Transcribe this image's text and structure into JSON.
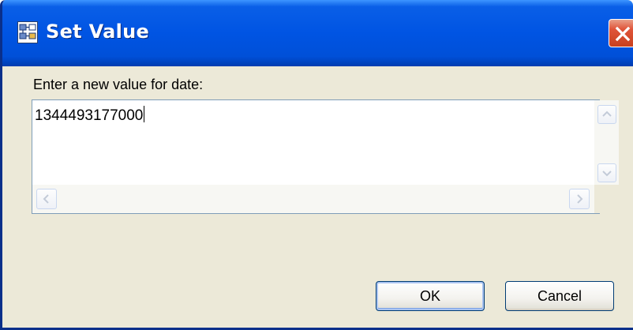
{
  "window": {
    "title": "Set Value",
    "app_icon": "dialog-app-icon",
    "close_icon": "close-icon"
  },
  "dialog": {
    "prompt": "Enter a new value for date:",
    "input_value": "1344493177000"
  },
  "buttons": {
    "ok_label": "OK",
    "cancel_label": "Cancel"
  },
  "colors": {
    "titlebar": "#0054e3",
    "window_bg": "#ece9d8",
    "close_button": "#e0553a",
    "input_border": "#7f9db9",
    "button_border": "#003c74"
  }
}
